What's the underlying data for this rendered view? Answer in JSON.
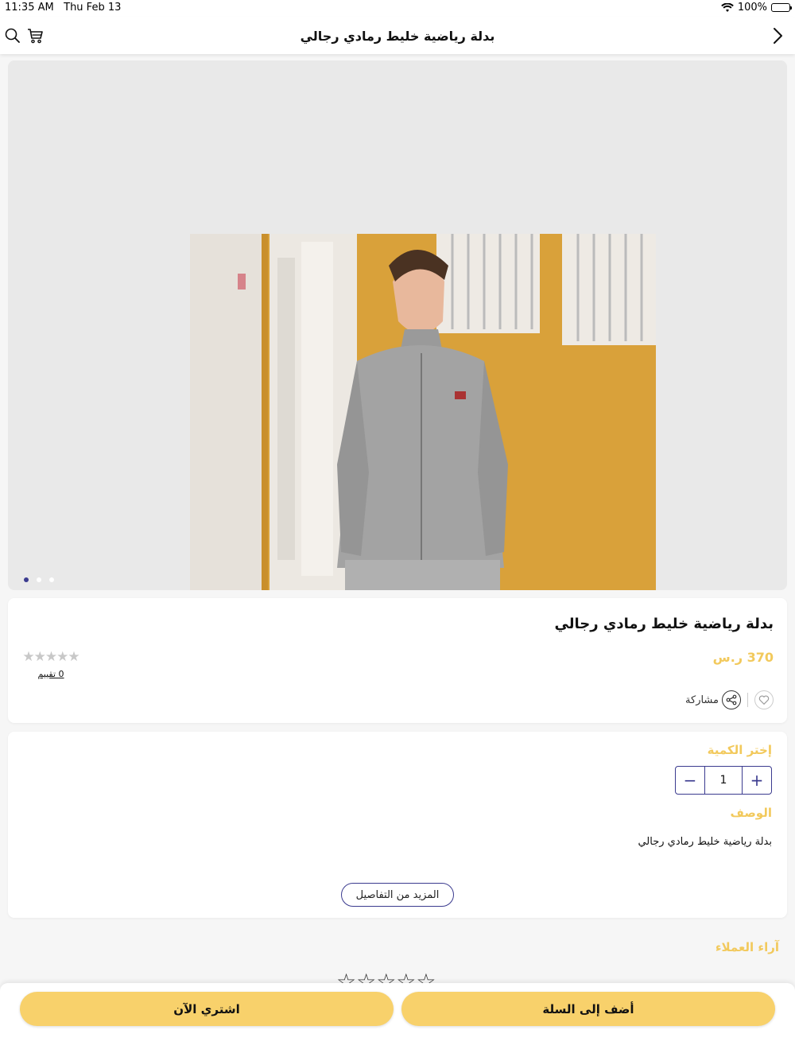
{
  "status_bar": {
    "time": "11:35 AM",
    "date": "Thu Feb 13",
    "battery": "100%"
  },
  "nav": {
    "title": "بدلة رياضية خليط رمادي رجالي",
    "icons": [
      "chevron-right-icon",
      "search-icon",
      "cart-icon"
    ]
  },
  "carousel": {
    "image_alt": "man wearing grey zip-up sport jacket",
    "dots": 3,
    "active_dot": 1
  },
  "product": {
    "title": "بدلة رياضية خليط رمادي رجالي",
    "price": "370 ر.س",
    "rating_stars": "★★★★★",
    "rating_count": "0 تقييم",
    "share_label": "مشاركة"
  },
  "details": {
    "quantity_label": "إختر الكمية",
    "quantity_value": "1",
    "minus": "−",
    "plus": "+",
    "description_label": "الوصف",
    "description_text": "بدلة رياضية خليط رمادي رجالي",
    "more_button": "المزيد من التفاصيل"
  },
  "reviews": {
    "title": "آراء العملاء",
    "stars": "☆☆☆☆☆"
  },
  "bottom": {
    "buy_now": "اشتري الآن",
    "add_to_cart": "أضف إلى السلة"
  },
  "colors": {
    "accent": "#f8d16b",
    "price": "#f2c95c",
    "primary": "#3b3b8f"
  }
}
